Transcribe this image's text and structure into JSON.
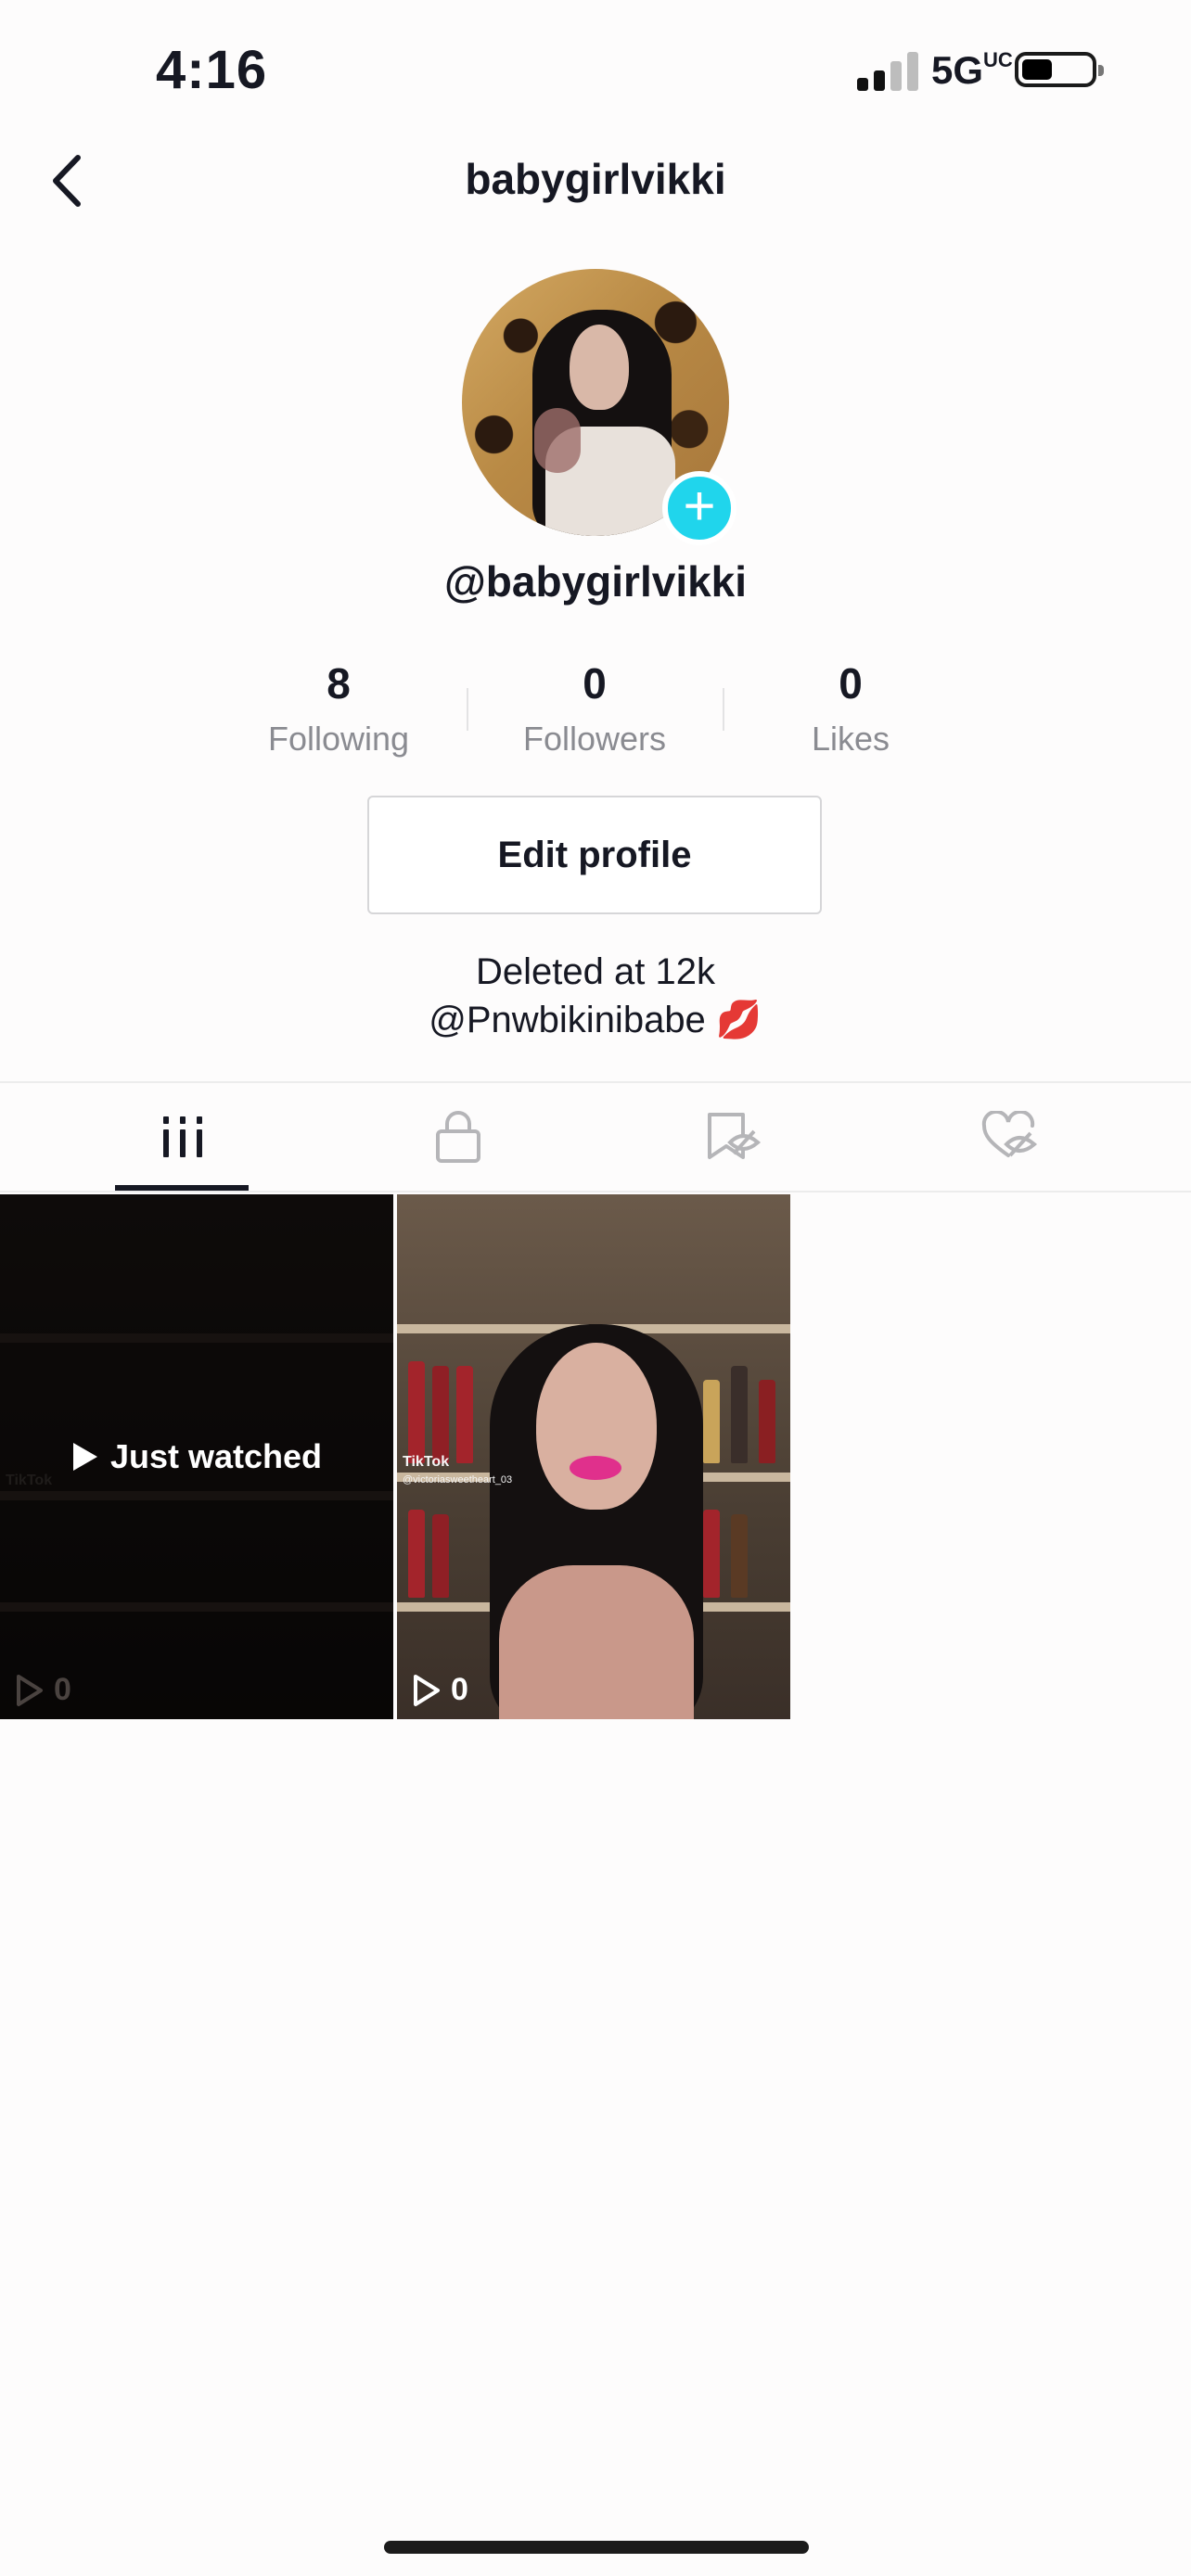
{
  "status_bar": {
    "time": "4:16",
    "network": "5G",
    "network_suffix": "UC"
  },
  "header": {
    "title": "babygirlvikki"
  },
  "profile": {
    "handle": "@babygirlvikki",
    "stats": [
      {
        "value": "8",
        "label": "Following"
      },
      {
        "value": "0",
        "label": "Followers"
      },
      {
        "value": "0",
        "label": "Likes"
      }
    ],
    "edit_label": "Edit profile",
    "bio_line1": "Deleted at 12k",
    "bio_line2": "@Pnwbikinibabe 💋"
  },
  "tabs": [
    {
      "icon": "grid-icon",
      "active": true
    },
    {
      "icon": "lock-icon",
      "active": false
    },
    {
      "icon": "hidden-bookmark-icon",
      "active": false
    },
    {
      "icon": "hidden-heart-icon",
      "active": false
    }
  ],
  "videos": [
    {
      "overlay_label": "Just watched",
      "plays": "0",
      "watermark": "TikTok"
    },
    {
      "plays": "0",
      "watermark": "TikTok",
      "watermark_user": "@victoriasweetheart_03"
    }
  ],
  "colors": {
    "accent": "#20d5ec",
    "text": "#161823",
    "muted": "#8a8b91"
  }
}
